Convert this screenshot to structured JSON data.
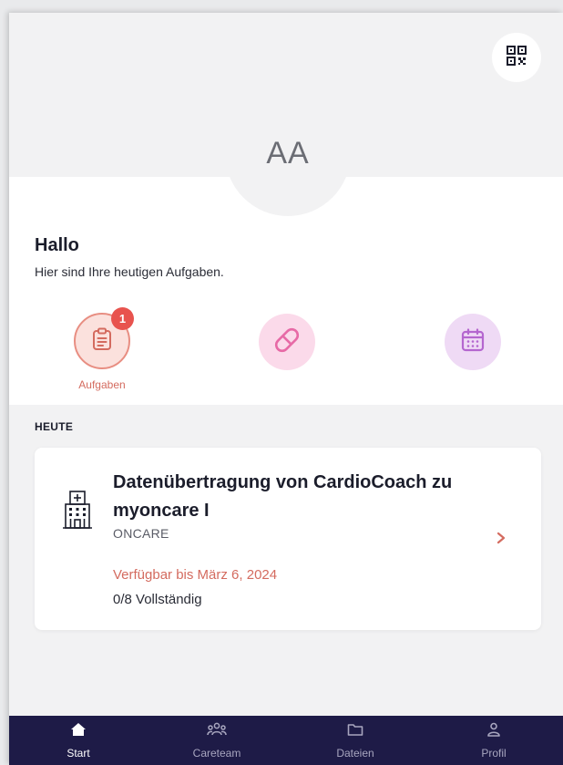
{
  "header": {
    "qr_icon": "qr-code-icon",
    "avatar_initials": "AA"
  },
  "greeting": {
    "title": "Hallo",
    "subtitle": "Hier sind Ihre heutigen Aufgaben."
  },
  "quick_actions": [
    {
      "icon": "clipboard-icon",
      "label": "Aufgaben",
      "badge": "1",
      "active": true
    },
    {
      "icon": "pill-icon",
      "label": ""
    },
    {
      "icon": "calendar-icon",
      "label": ""
    }
  ],
  "section": {
    "title": "HEUTE"
  },
  "card": {
    "icon": "hospital-icon",
    "title": "Datenübertragung von CardioCoach zu myoncare I",
    "org": "ONCARE",
    "available": "Verfügbar bis März 6, 2024",
    "progress": "0/8 Vollständig"
  },
  "tabbar": [
    {
      "label": "Start",
      "icon": "home-icon",
      "active": true
    },
    {
      "label": "Careteam",
      "icon": "team-icon"
    },
    {
      "label": "Dateien",
      "icon": "folder-icon"
    },
    {
      "label": "Profil",
      "icon": "user-icon"
    }
  ],
  "colors": {
    "accent_coral": "#d46b5f",
    "badge_red": "#e8534e",
    "tabbar_navy": "#1e1b47",
    "pill_pink": "#e76aa6",
    "calendar_purple": "#b466cf"
  }
}
